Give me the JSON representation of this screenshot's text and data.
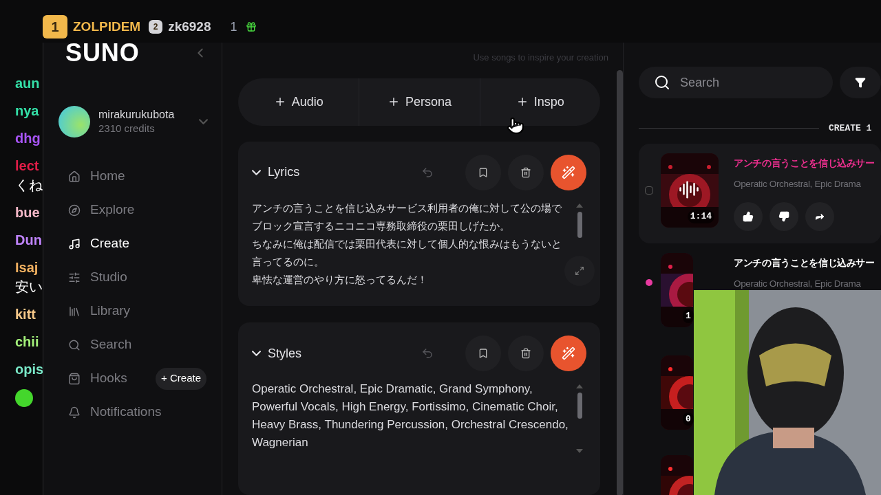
{
  "ranking": {
    "entries": [
      {
        "rank": "1",
        "name": "ZOLPIDEM",
        "color": "#f2b84b"
      },
      {
        "rank": "2",
        "name": "zk6928",
        "color": "#d4d4d8"
      }
    ],
    "gift_count": "1"
  },
  "chat": [
    {
      "kind": "name",
      "text": "aun",
      "color": "#34e0a8"
    },
    {
      "kind": "name",
      "text": "nya",
      "color": "#34e0a8"
    },
    {
      "kind": "name",
      "text": "dhg",
      "color": "#a855f7"
    },
    {
      "kind": "name",
      "text": "lect",
      "color": "#e11d48"
    },
    {
      "kind": "message",
      "text": "くね"
    },
    {
      "kind": "name",
      "text": "bue",
      "color": "#f5b8c8"
    },
    {
      "kind": "name",
      "text": "Dun",
      "color": "#c084fc"
    },
    {
      "kind": "name",
      "text": "Isaj",
      "color": "#f0b060"
    },
    {
      "kind": "message",
      "text": "安い"
    },
    {
      "kind": "name",
      "text": "kitt",
      "color": "#f7c98a"
    },
    {
      "kind": "name",
      "text": "chii",
      "color": "#a3f07a"
    },
    {
      "kind": "name",
      "text": "opis",
      "color": "#7ae8c8"
    }
  ],
  "app": {
    "logo": "SUNO",
    "user": {
      "name": "mirakurukubota",
      "credits": "2310 credits"
    },
    "nav": [
      {
        "label": "Home",
        "selected": false
      },
      {
        "label": "Explore",
        "selected": false
      },
      {
        "label": "Create",
        "selected": true
      },
      {
        "label": "Studio",
        "selected": false
      },
      {
        "label": "Library",
        "selected": false
      },
      {
        "label": "Search",
        "selected": false
      },
      {
        "label": "Hooks",
        "selected": false,
        "action": "+ Create"
      },
      {
        "label": "Notifications",
        "selected": false
      }
    ],
    "hint": "Use songs to inspire your creation",
    "add_buttons": [
      "Audio",
      "Persona",
      "Inspo"
    ],
    "sections": [
      {
        "title": "Lyrics",
        "expanded": true,
        "lines": [
          "アンチの言うことを信じ込みサービス利用者の俺に対して公の場でブロック宣言するニコニコ専務取締役の栗田しげたか。",
          "ちなみに俺は配信では栗田代表に対して個人的な恨みはもうないと言ってるのに。",
          "卑怯な運営のやり方に怒ってるんだ！"
        ]
      },
      {
        "title": "Styles",
        "expanded": true,
        "lines": [
          "Operatic Orchestral, Epic Dramatic, Grand Symphony, Powerful Vocals, High Energy, Fortissimo, Cinematic Choir, Heavy Brass, Thundering Percussion, Orchestral Crescendo, Wagnerian"
        ]
      }
    ],
    "search": {
      "placeholder": "Search"
    },
    "list_heading": "CREATE 1",
    "songs": [
      {
        "kind": "full",
        "title": "アンチの言うことを信じ込みサー",
        "subtitle": "Operatic Orchestral, Epic Drama",
        "duration": "1:14",
        "highlighted": true,
        "new": false,
        "hovered": true,
        "checked": false
      },
      {
        "kind": "full",
        "title": "アンチの言うことを信じ込みサー",
        "subtitle": "Operatic Orchestral, Epic Drama",
        "duration": "1",
        "highlighted": false,
        "new": true,
        "hovered": false
      },
      {
        "kind": "thumbnail-only",
        "duration": "0"
      },
      {
        "kind": "thumbnail-only"
      }
    ]
  }
}
